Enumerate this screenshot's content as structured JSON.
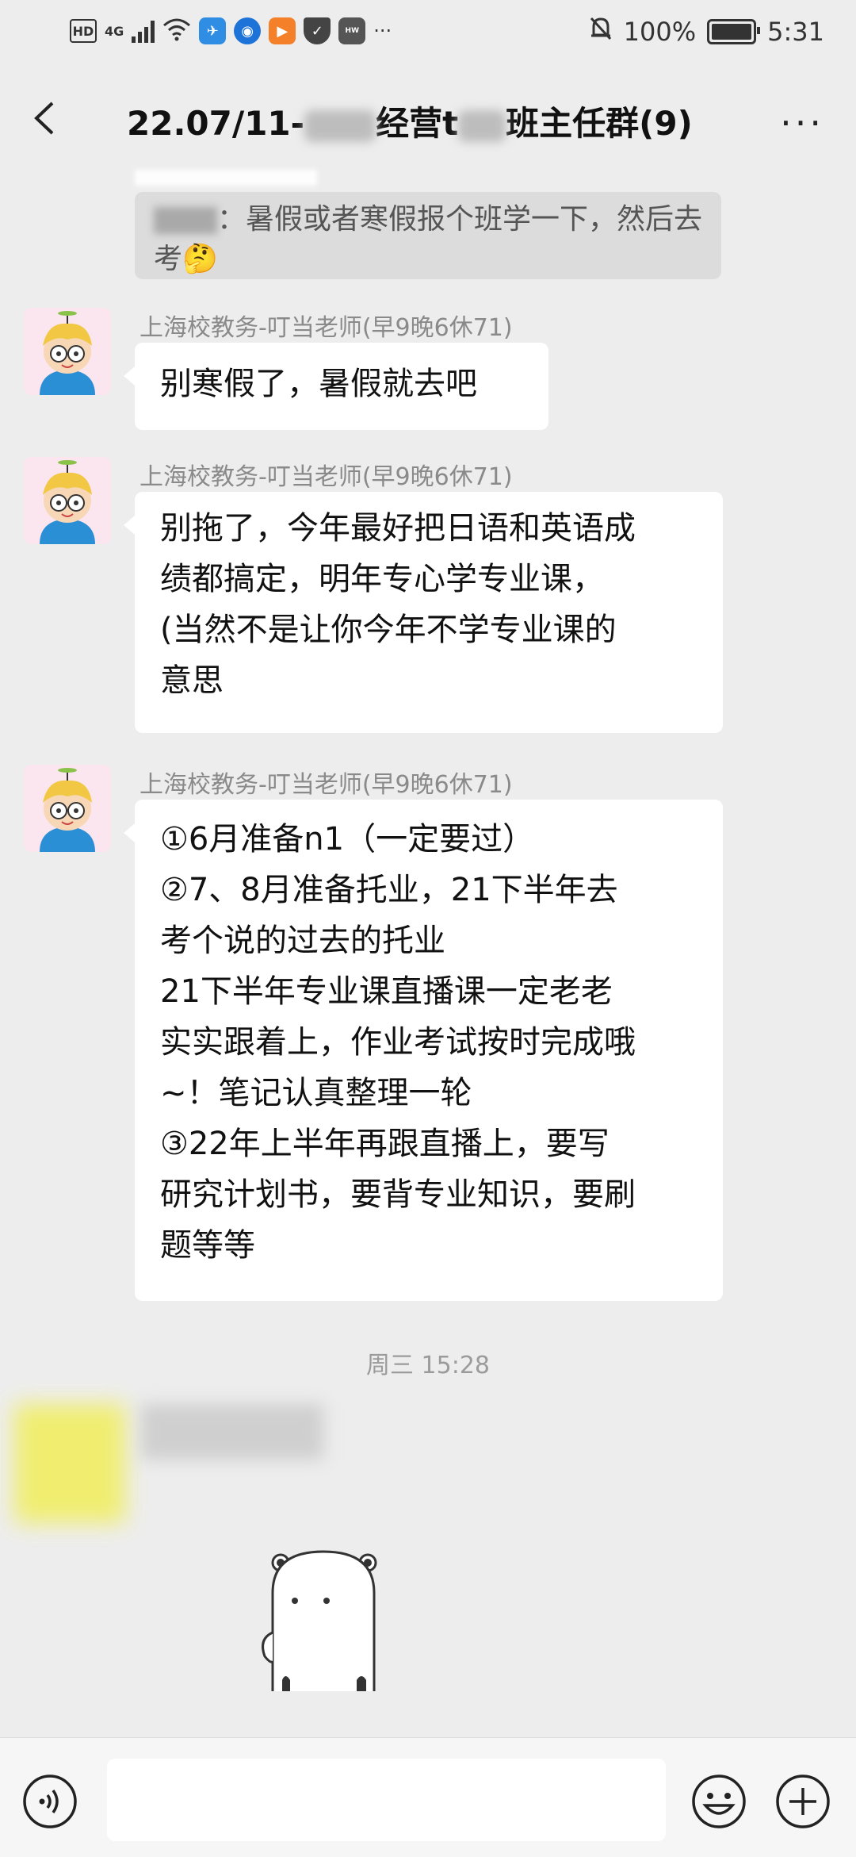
{
  "status_bar": {
    "hd": "HD",
    "network": "4G",
    "battery_percent": "100%",
    "time": "5:31",
    "overflow": "···"
  },
  "header": {
    "title_prefix": "22.07/11-",
    "title_mid": "经营t",
    "title_suffix": "班主任群(9)",
    "more": "···"
  },
  "quote": {
    "text": "：暑假或者寒假报个班学一下，然后去考🤔"
  },
  "messages": [
    {
      "sender": "上海校教务-叮当老师(早9晚6休71)",
      "lines": [
        "别寒假了，暑假就去吧"
      ]
    },
    {
      "sender": "上海校教务-叮当老师(早9晚6休71)",
      "lines": [
        "别拖了，今年最好把日语和英语成",
        "绩都搞定，明年专心学专业课，",
        "(当然不是让你今年不学专业课的",
        "意思"
      ]
    },
    {
      "sender": "上海校教务-叮当老师(早9晚6休71)",
      "lines": [
        "①6月准备n1（一定要过）",
        "②7、8月准备托业，21下半年去",
        "考个说的过去的托业",
        "21下半年专业课直播课一定老老",
        "实实跟着上，作业考试按时完成哦",
        "~！笔记认真整理一轮",
        "③22年上半年再跟直播上，要写",
        "研究计划书，要背专业知识，要刷",
        "题等等"
      ]
    }
  ],
  "timestamp": "周三 15:28",
  "colors": {
    "background": "#ededed",
    "bubble": "#ffffff",
    "quote_bg": "#dcdcdc",
    "sender_text": "#8a8a8a"
  }
}
